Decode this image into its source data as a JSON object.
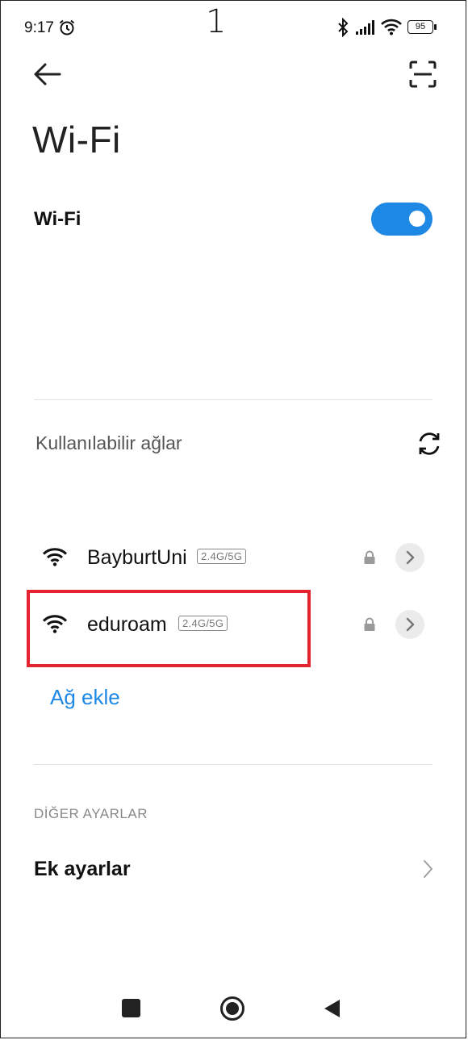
{
  "status_bar": {
    "time": "9:17",
    "battery": "95",
    "icons": [
      "alarm-icon",
      "bluetooth-icon",
      "signal-icon",
      "wifi-icon",
      "battery-icon"
    ]
  },
  "annotation": {
    "step_number": "1"
  },
  "header": {
    "title": "Wi-Fi"
  },
  "wifi_toggle": {
    "label": "Wi-Fi",
    "enabled": true,
    "color": "#1e88e5"
  },
  "available": {
    "title": "Kullanılabilir ağlar"
  },
  "networks": [
    {
      "name": "BayburtUni",
      "band": "2.4G/5G",
      "secured": true
    },
    {
      "name": "eduroam",
      "band": "2.4G/5G",
      "secured": true
    }
  ],
  "add_network": {
    "label": "Ağ ekle"
  },
  "other_settings": {
    "title": "DİĞER AYARLAR",
    "items": [
      {
        "label": "Ek ayarlar"
      }
    ]
  },
  "highlight_color": "#e3232d"
}
